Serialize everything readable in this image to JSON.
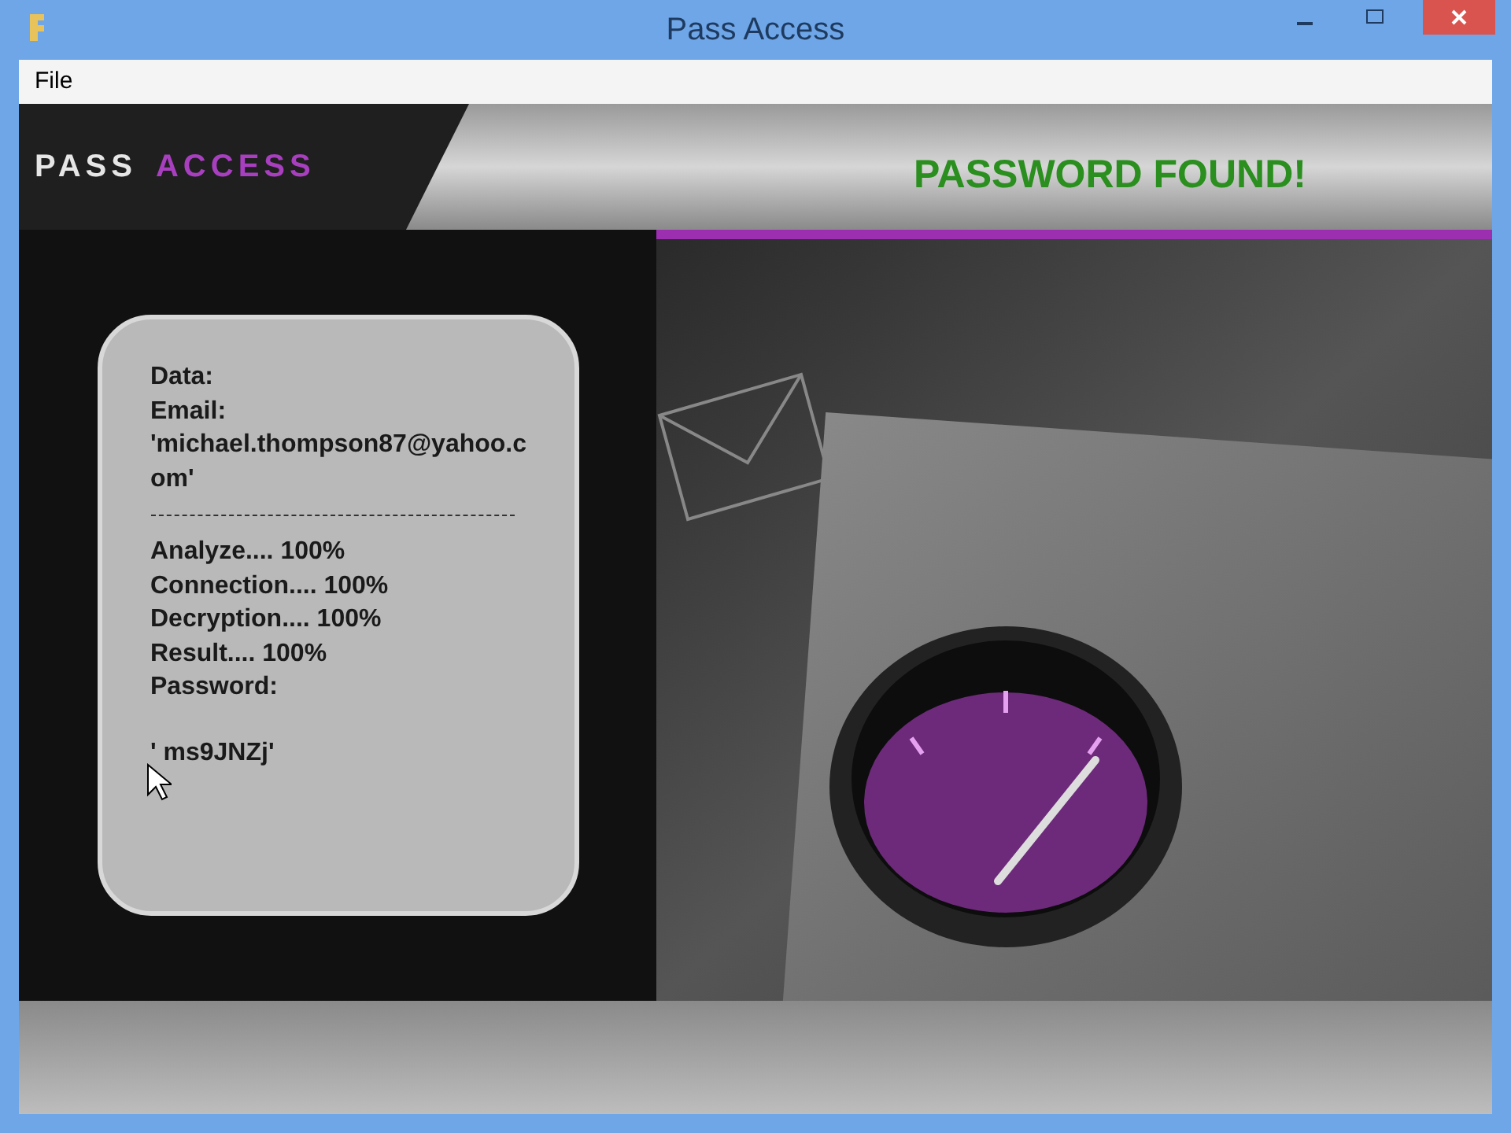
{
  "window": {
    "title": "Pass Access"
  },
  "menu": [
    "File"
  ],
  "logo": {
    "part_1": "PASS",
    "part_2": "ACCESS"
  },
  "status": "PASSWORD FOUND!",
  "report": {
    "lines": [
      "Data:",
      "Email:",
      "'michael.thompson87@yahoo.com'"
    ],
    "progress": [
      "Analyze.... 100%",
      "Connection.... 100%",
      "Decryption.... 100%",
      "Result.... 100%",
      "Password:"
    ],
    "password": "' ms9JNZj'"
  }
}
